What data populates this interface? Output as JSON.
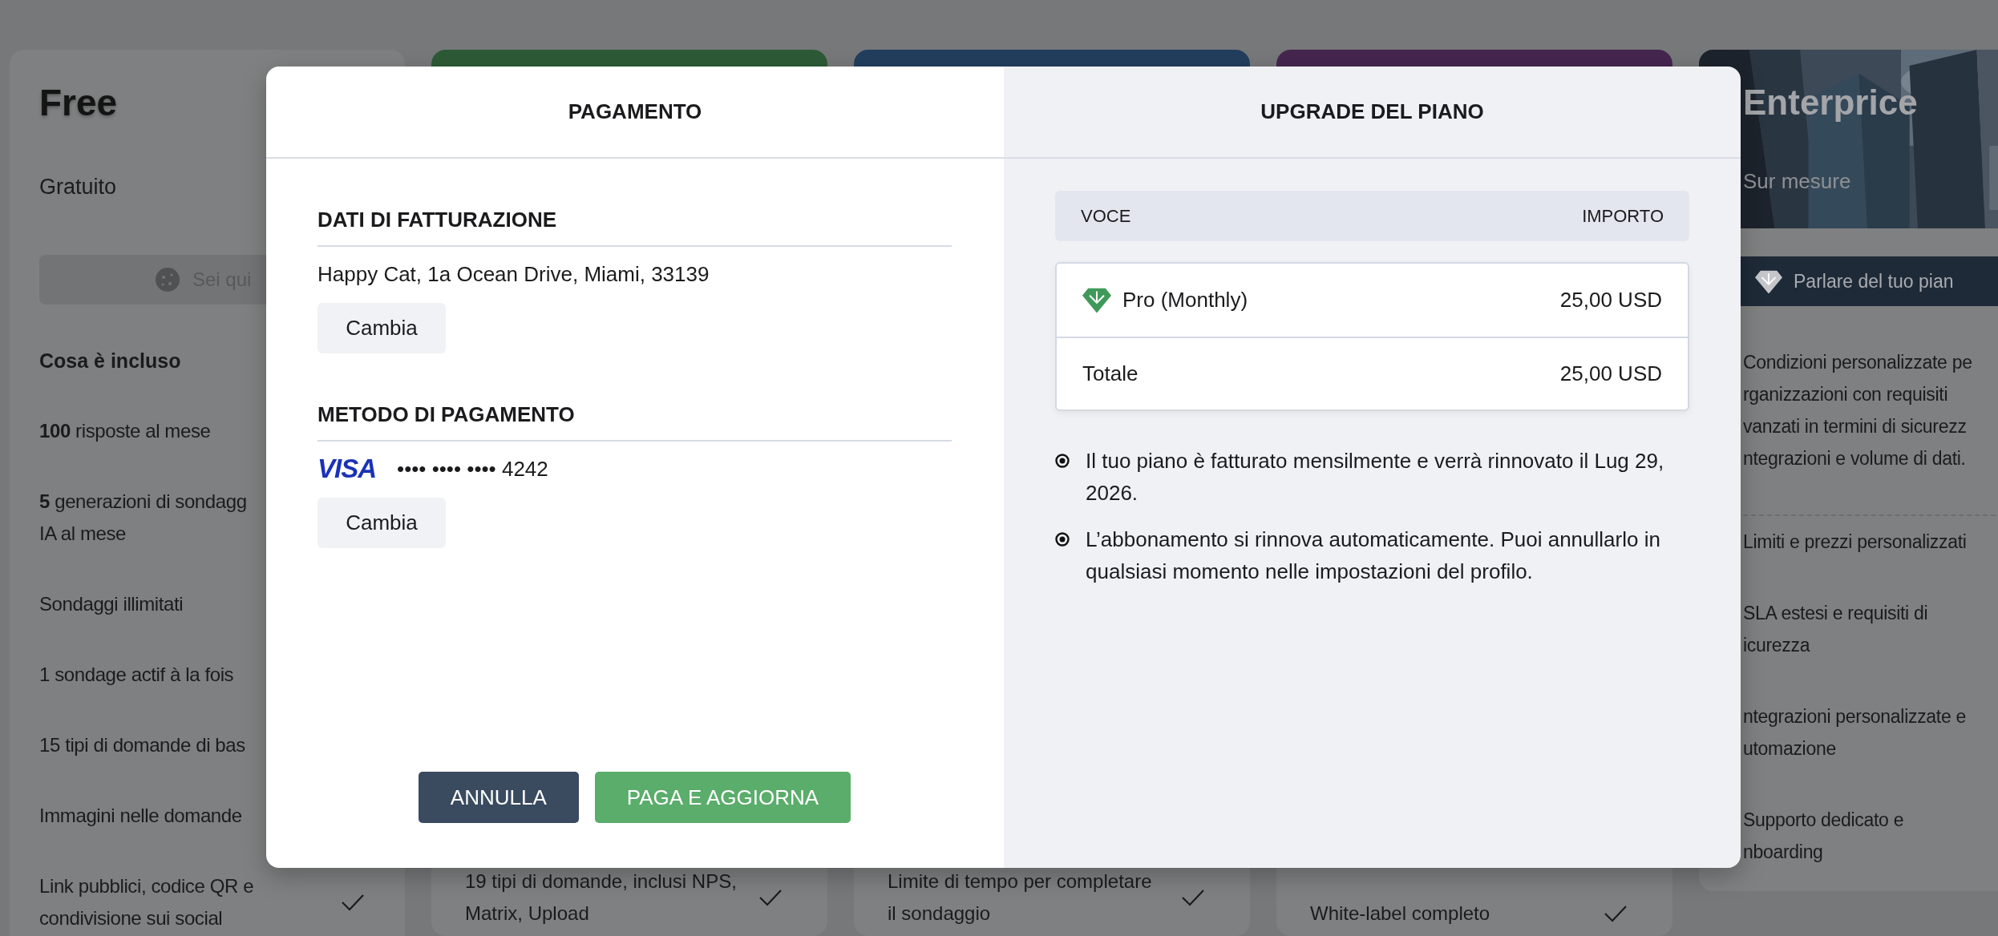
{
  "plans": [
    {
      "kind": "free",
      "title": "Free",
      "price": "Gratuito",
      "button": {
        "label": "Sei qui"
      },
      "section_title": "Cosa è incluso",
      "features": [
        {
          "lines": [
            "**100** risposte al mese"
          ]
        },
        {
          "lines": [
            "**5** generazioni di sondagg",
            "IA al mese"
          ]
        },
        {
          "lines": [
            "Sondaggi illimitati"
          ]
        },
        {
          "lines": [
            "1 sondage actif à la fois"
          ]
        },
        {
          "lines": [
            "15 tipi di domande di bas"
          ]
        },
        {
          "lines": [
            "Immagini nelle domande"
          ]
        },
        {
          "lines": [
            "Link pubblici, codice QR e",
            "condivisione sui social"
          ],
          "checked": true
        }
      ]
    },
    {
      "kind": "colored",
      "color": "#2d5a36",
      "features": [
        {
          "lines": [
            "19 tipi di domande, inclusi NPS,",
            "Matrix, Upload"
          ],
          "checked": true
        }
      ]
    },
    {
      "kind": "colored",
      "color": "#223e5e",
      "features": [
        {
          "lines": [
            "Limite di tempo per completare",
            "il sondaggio"
          ],
          "checked": true
        }
      ]
    },
    {
      "kind": "colored",
      "color": "#45264f",
      "features": [
        {
          "lines": [
            "White-label completo"
          ],
          "checked": true
        }
      ]
    },
    {
      "kind": "enterprise",
      "title": "Enterprice",
      "price": "Sur mesure",
      "button": {
        "label": "Parlare del tuo pian"
      },
      "description": [
        "Condizioni personalizzate pe",
        "rganizzazioni con requisiti",
        "vanzati in termini di sicurezz",
        "ntegrazioni e volume di dati."
      ],
      "features": [
        {
          "lines": [
            "Limiti e prezzi personalizzati"
          ]
        },
        {
          "lines": [
            "SLA estesi e requisiti di",
            "icurezza"
          ]
        },
        {
          "lines": [
            "ntegrazioni personalizzate e",
            "utomazione"
          ]
        },
        {
          "lines": [
            "Supporto dedicato e",
            "nboarding"
          ]
        }
      ]
    }
  ],
  "modal": {
    "payment": {
      "title": "PAGAMENTO",
      "sections": [
        {
          "kind": "billing",
          "title": "DATI DI FATTURAZIONE",
          "text": "Happy Cat, 1a Ocean Drive, Miami, 33139",
          "button": "Cambia"
        },
        {
          "kind": "card",
          "title": "METODO DI PAGAMENTO",
          "brand": "VISA",
          "text": "•••• •••• •••• 4242",
          "button": "Cambia"
        }
      ],
      "actions": [
        {
          "label": "ANNULLA",
          "kind": "secondary"
        },
        {
          "label": "PAGA E AGGIORNA",
          "kind": "primary"
        }
      ]
    },
    "summary": {
      "title": "UPGRADE DEL PIANO",
      "columns": [
        "VOCE",
        "IMPORTO"
      ],
      "rows": [
        {
          "kind": "item",
          "label": "Pro (Monthly)",
          "amount": "25,00 USD"
        },
        {
          "kind": "total",
          "label": "Totale",
          "amount": "25,00 USD"
        }
      ],
      "notes": [
        "Il tuo piano è fatturato mensilmente e verrà rinnovato il Lug 29, 2026.",
        "L’abbonamento si rinnova automaticamente. Puoi annullarlo in qualsiasi momento nelle impostazioni del profilo."
      ]
    }
  }
}
